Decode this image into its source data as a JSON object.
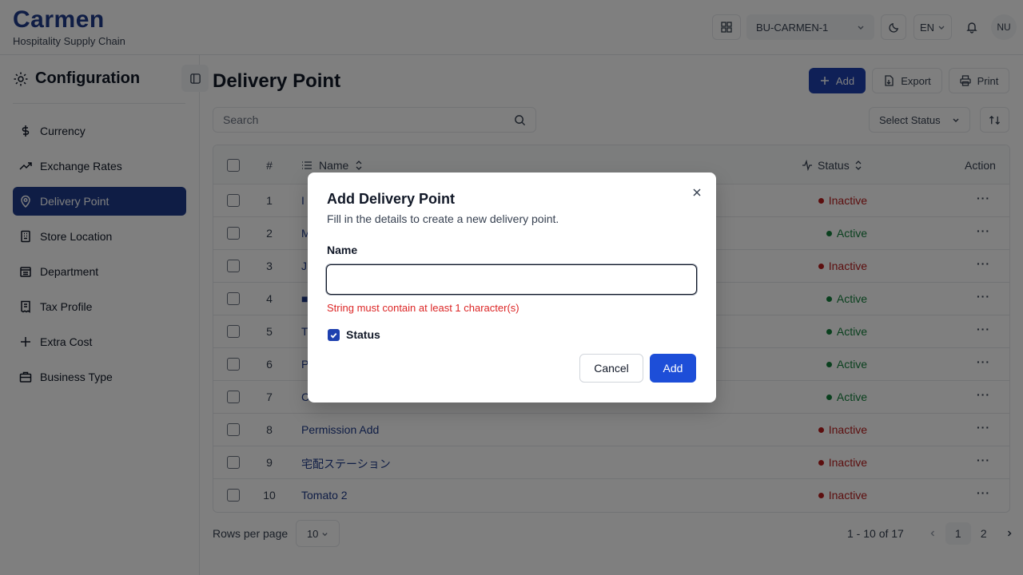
{
  "brand": {
    "name": "Carmen",
    "subtitle": "Hospitality Supply Chain"
  },
  "header": {
    "business_unit": "BU-CARMEN-1",
    "language": "EN",
    "user_initials": "NU"
  },
  "sidebar": {
    "title": "Configuration",
    "items": [
      {
        "label": "Currency",
        "icon": "dollar-icon"
      },
      {
        "label": "Exchange Rates",
        "icon": "trending-up-icon"
      },
      {
        "label": "Delivery Point",
        "icon": "map-pin-icon",
        "active": true
      },
      {
        "label": "Store Location",
        "icon": "building-icon"
      },
      {
        "label": "Department",
        "icon": "department-icon"
      },
      {
        "label": "Tax Profile",
        "icon": "receipt-icon"
      },
      {
        "label": "Extra Cost",
        "icon": "plus-icon"
      },
      {
        "label": "Business Type",
        "icon": "briefcase-icon"
      }
    ]
  },
  "main": {
    "title": "Delivery Point",
    "actions": {
      "add": "Add",
      "export": "Export",
      "print": "Print"
    },
    "search_placeholder": "Search",
    "status_filter": "Select Status"
  },
  "table": {
    "headers": {
      "num": "#",
      "name": "Name",
      "status": "Status",
      "action": "Action"
    },
    "rows": [
      {
        "num": "1",
        "name": "I",
        "status": "Inactive"
      },
      {
        "num": "2",
        "name": "M",
        "status": "Active"
      },
      {
        "num": "3",
        "name": "J",
        "status": "Inactive"
      },
      {
        "num": "4",
        "name": "■",
        "status": "Active"
      },
      {
        "num": "5",
        "name": "T",
        "status": "Active"
      },
      {
        "num": "6",
        "name": "P",
        "status": "Active"
      },
      {
        "num": "7",
        "name": "C",
        "status": "Active"
      },
      {
        "num": "8",
        "name": "Permission Add",
        "status": "Inactive"
      },
      {
        "num": "9",
        "name": "宅配ステーション",
        "status": "Inactive"
      },
      {
        "num": "10",
        "name": "Tomato 2",
        "status": "Inactive"
      }
    ],
    "action_glyph": "···"
  },
  "footer": {
    "rows_label": "Rows per page",
    "rows_value": "10",
    "range": "1 - 10 of 17",
    "pages": [
      "1",
      "2"
    ],
    "current_page": "1"
  },
  "colors": {
    "active": "#15803d",
    "inactive": "#b91c1c",
    "primary": "#1e40af"
  },
  "modal": {
    "title": "Add Delivery Point",
    "description": "Fill in the details to create a new delivery point.",
    "name_label": "Name",
    "name_value": "",
    "error": "String must contain at least 1 character(s)",
    "status_label": "Status",
    "status_checked": true,
    "cancel": "Cancel",
    "submit": "Add"
  }
}
